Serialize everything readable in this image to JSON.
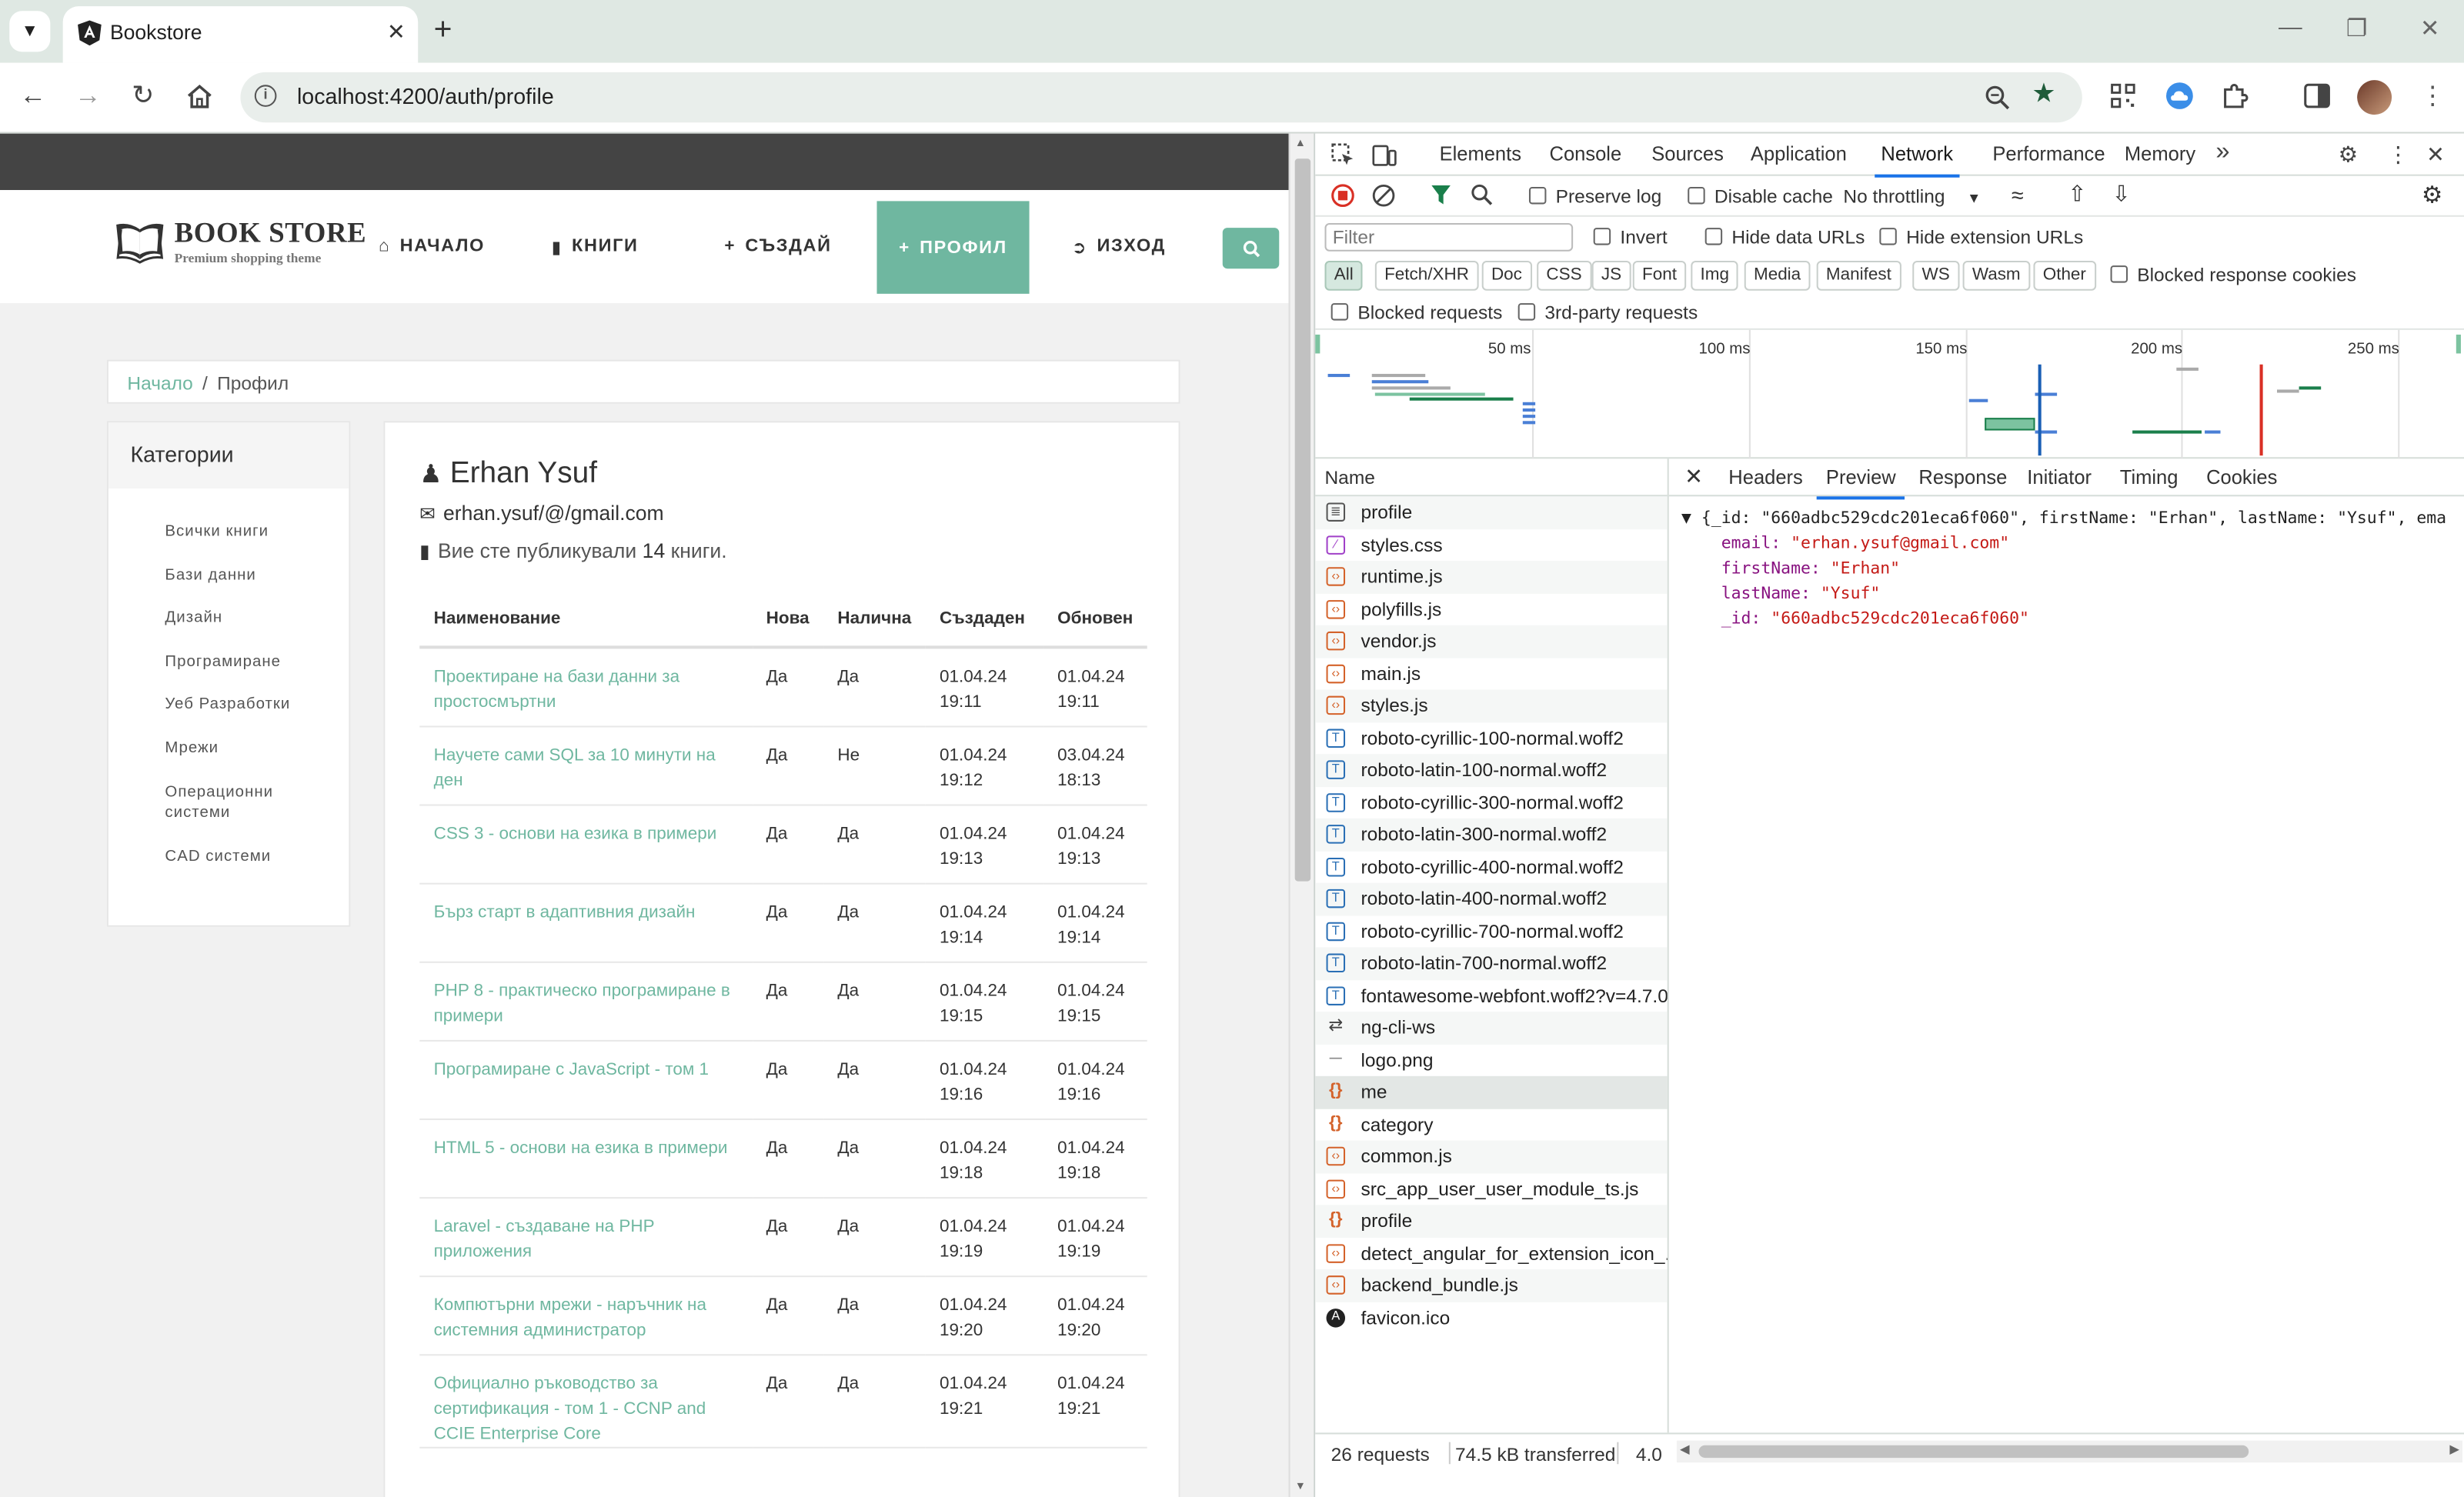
{
  "browser": {
    "tab_title": "Bookstore",
    "url": "localhost:4200/auth/profile"
  },
  "site": {
    "logo_title": "BOOK STORE",
    "logo_subtitle": "Premium shopping theme",
    "nav": {
      "home": "НАЧАЛО",
      "books": "КНИГИ",
      "create": "СЪЗДАЙ",
      "profile": "ПРОФИЛ",
      "logout": "ИЗХОД"
    },
    "breadcrumb": {
      "home": "Начало",
      "current": "Профил"
    },
    "categories": {
      "title": "Категории",
      "items": [
        "Всички книги",
        "Бази данни",
        "Дизайн",
        "Програмиране",
        "Уеб Разработки",
        "Мрежи",
        "Операционни системи",
        "CAD системи"
      ]
    },
    "profile": {
      "name": "Erhan Ysuf",
      "email": "erhan.ysuf/@/gmail.com",
      "published_prefix": "Вие сте публикували",
      "published_count": "14",
      "published_suffix": "книги."
    },
    "table": {
      "headers": [
        "Наименование",
        "Нова",
        "Налична",
        "Създаден",
        "Обновен"
      ],
      "rows": [
        [
          "Проектиране на бази данни за простосмъртни",
          "Да",
          "Да",
          "01.04.24 19:11",
          "01.04.24 19:11"
        ],
        [
          "Научете сами SQL за 10 минути на ден",
          "Да",
          "Не",
          "01.04.24 19:12",
          "03.04.24 18:13"
        ],
        [
          "CSS 3 - основи на езика в примери",
          "Да",
          "Да",
          "01.04.24 19:13",
          "01.04.24 19:13"
        ],
        [
          "Бърз старт в адаптивния дизайн",
          "Да",
          "Да",
          "01.04.24 19:14",
          "01.04.24 19:14"
        ],
        [
          "PHP 8 - практическо програмиране в примери",
          "Да",
          "Да",
          "01.04.24 19:15",
          "01.04.24 19:15"
        ],
        [
          "Програмиране с JavaScript - том 1",
          "Да",
          "Да",
          "01.04.24 19:16",
          "01.04.24 19:16"
        ],
        [
          "HTML 5 - основи на езика в примери",
          "Да",
          "Да",
          "01.04.24 19:18",
          "01.04.24 19:18"
        ],
        [
          "Laravel - създаване на PHP приложения",
          "Да",
          "Да",
          "01.04.24 19:19",
          "01.04.24 19:19"
        ],
        [
          "Компютърни мрежи - наръчник на системния администратор",
          "Да",
          "Да",
          "01.04.24 19:20",
          "01.04.24 19:20"
        ],
        [
          "Официално ръководство за сертификация - том 1 - CCNP and CCIE Enterprise Core",
          "Да",
          "Да",
          "01.04.24 19:21",
          "01.04.24 19:21"
        ]
      ]
    }
  },
  "devtools": {
    "tabs": [
      "Elements",
      "Console",
      "Sources",
      "Application",
      "Network",
      "Performance",
      "Memory"
    ],
    "active_tab": "Network",
    "toolbar": {
      "preserve_log": "Preserve log",
      "disable_cache": "Disable cache",
      "throttling": "No throttling"
    },
    "filter": {
      "placeholder": "Filter",
      "invert": "Invert",
      "hide_data_urls": "Hide data URLs",
      "hide_extension_urls": "Hide extension URLs"
    },
    "types": [
      "All",
      "Fetch/XHR",
      "Doc",
      "CSS",
      "JS",
      "Font",
      "Img",
      "Media",
      "Manifest",
      "WS",
      "Wasm",
      "Other"
    ],
    "blocked_response_cookies": "Blocked response cookies",
    "blocked_requests": "Blocked requests",
    "third_party_requests": "3rd-party requests",
    "timeline_labels": [
      "50 ms",
      "100 ms",
      "150 ms",
      "200 ms",
      "250 ms"
    ],
    "name_header": "Name",
    "requests": [
      {
        "name": "profile",
        "type": "doc"
      },
      {
        "name": "styles.css",
        "type": "css"
      },
      {
        "name": "runtime.js",
        "type": "js"
      },
      {
        "name": "polyfills.js",
        "type": "js"
      },
      {
        "name": "vendor.js",
        "type": "js"
      },
      {
        "name": "main.js",
        "type": "js"
      },
      {
        "name": "styles.js",
        "type": "js"
      },
      {
        "name": "roboto-cyrillic-100-normal.woff2",
        "type": "font"
      },
      {
        "name": "roboto-latin-100-normal.woff2",
        "type": "font"
      },
      {
        "name": "roboto-cyrillic-300-normal.woff2",
        "type": "font"
      },
      {
        "name": "roboto-latin-300-normal.woff2",
        "type": "font"
      },
      {
        "name": "roboto-cyrillic-400-normal.woff2",
        "type": "font"
      },
      {
        "name": "roboto-latin-400-normal.woff2",
        "type": "font"
      },
      {
        "name": "roboto-cyrillic-700-normal.woff2",
        "type": "font"
      },
      {
        "name": "roboto-latin-700-normal.woff2",
        "type": "font"
      },
      {
        "name": "fontawesome-webfont.woff2?v=4.7.0",
        "type": "font"
      },
      {
        "name": "ng-cli-ws",
        "type": "ws"
      },
      {
        "name": "logo.png",
        "type": "img"
      },
      {
        "name": "me",
        "type": "xhr"
      },
      {
        "name": "category",
        "type": "xhr"
      },
      {
        "name": "common.js",
        "type": "js"
      },
      {
        "name": "src_app_user_user_module_ts.js",
        "type": "js"
      },
      {
        "name": "profile",
        "type": "xhr"
      },
      {
        "name": "detect_angular_for_extension_icon_...",
        "type": "js"
      },
      {
        "name": "backend_bundle.js",
        "type": "js"
      },
      {
        "name": "favicon.ico",
        "type": "fav"
      }
    ],
    "selected_request": "me",
    "detail_tabs": [
      "Headers",
      "Preview",
      "Response",
      "Initiator",
      "Timing",
      "Cookies"
    ],
    "active_detail_tab": "Preview",
    "preview": {
      "summary": "{_id: \"660adbc529cdc201eca6f060\", firstName: \"Erhan\", lastName: \"Ysuf\", ema",
      "email_key": "email:",
      "email_val": "\"erhan.ysuf@gmail.com\"",
      "first_key": "firstName:",
      "first_val": "\"Erhan\"",
      "last_key": "lastName:",
      "last_val": "\"Ysuf\"",
      "id_key": "_id:",
      "id_val": "\"660adbc529cdc201eca6f060\""
    },
    "status": {
      "requests": "26 requests",
      "transferred": "74.5 kB transferred",
      "extra": "4.0"
    }
  }
}
